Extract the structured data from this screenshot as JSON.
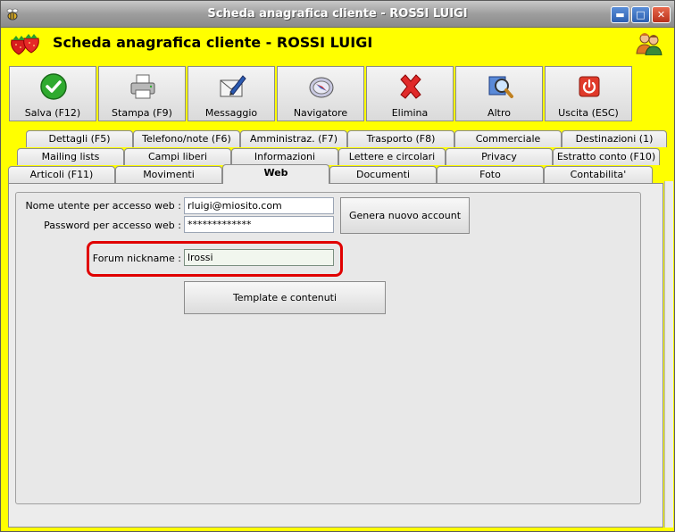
{
  "window": {
    "title": "Scheda anagrafica cliente - ROSSI LUIGI",
    "controls": {
      "minimize": "▬",
      "maximize": "□",
      "close": "✕"
    }
  },
  "header": {
    "title": "Scheda anagrafica cliente - ROSSI LUIGI"
  },
  "toolbar": {
    "buttons": [
      {
        "label": "Salva (F12)",
        "icon": "checkmark-icon"
      },
      {
        "label": "Stampa (F9)",
        "icon": "printer-icon"
      },
      {
        "label": "Messaggio",
        "icon": "envelope-pen-icon"
      },
      {
        "label": "Navigatore",
        "icon": "compass-icon"
      },
      {
        "label": "Elimina",
        "icon": "red-x-icon"
      },
      {
        "label": "Altro",
        "icon": "magnifier-icon"
      },
      {
        "label": "Uscita (ESC)",
        "icon": "power-icon"
      }
    ]
  },
  "tabs": {
    "row1": [
      "Dettagli (F5)",
      "Telefono/note (F6)",
      "Amministraz. (F7)",
      "Trasporto (F8)",
      "Commerciale",
      "Destinazioni (1)"
    ],
    "row2": [
      "Mailing lists",
      "Campi liberi",
      "Informazioni",
      "Lettere e circolari",
      "Privacy",
      "Estratto conto (F10)"
    ],
    "row3": [
      "Articoli (F11)",
      "Movimenti",
      "Web",
      "Documenti",
      "Foto",
      "Contabilita'"
    ],
    "active": "Web"
  },
  "web": {
    "username_label": "Nome utente per accesso web :",
    "username_value": "rluigi@miosito.com",
    "password_label": "Password per accesso web :",
    "password_value": "*************",
    "nickname_label": "Forum nickname :",
    "nickname_value": "lrossi",
    "generate_button": "Genera nuovo account",
    "template_button": "Template e contenuti"
  },
  "colors": {
    "background": "#ffff00",
    "highlight": "#e00000"
  }
}
